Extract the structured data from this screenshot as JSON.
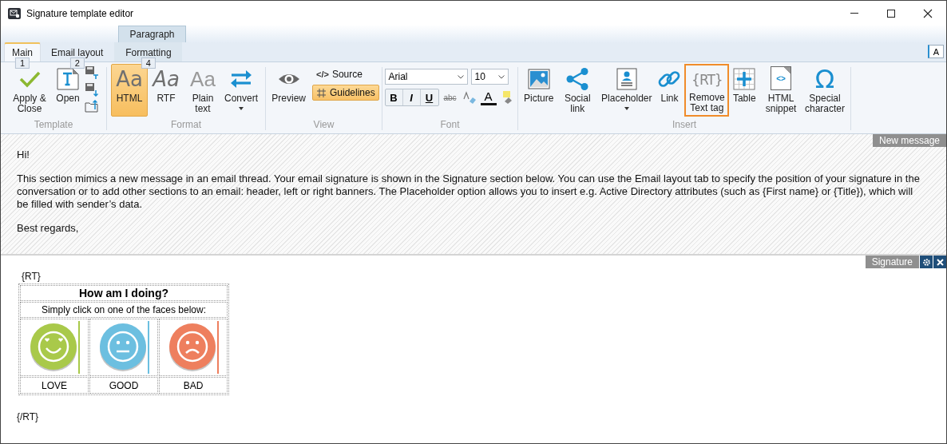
{
  "window": {
    "title": "Signature template editor"
  },
  "context_tab": {
    "label": "Paragraph"
  },
  "tabs": [
    {
      "label": "Main",
      "selected": true,
      "key_tip": "1"
    },
    {
      "label": "Email layout",
      "selected": false,
      "key_tip": "2"
    },
    {
      "label": "Formatting",
      "selected": false,
      "key_tip": "4"
    }
  ],
  "ribbon_corner_button": {
    "label": "A"
  },
  "ribbon": {
    "groups": [
      {
        "label": "Template",
        "buttons": [
          {
            "label": "Apply & Close"
          },
          {
            "label": "Open"
          }
        ]
      },
      {
        "label": "Format",
        "buttons": [
          {
            "label": "HTML",
            "icon_text": "Aa",
            "selected": true
          },
          {
            "label": "RTF",
            "icon_text": "Aa",
            "selected": false
          },
          {
            "label": "Plain text",
            "icon_text": "Aa",
            "selected": false
          },
          {
            "label": "Convert",
            "dropdown": true
          }
        ]
      },
      {
        "label": "View",
        "buttons": [
          {
            "label": "Preview"
          },
          {
            "label": "Source",
            "icon_text": "</>"
          },
          {
            "label": "Guidelines",
            "on": true
          }
        ]
      },
      {
        "label": "Font",
        "font_name": "Arial",
        "font_size": "10",
        "buttons": [
          {
            "label": "B"
          },
          {
            "label": "I"
          },
          {
            "label": "U"
          },
          {
            "label": "abc"
          },
          {
            "label": "A"
          }
        ]
      },
      {
        "label": "Insert",
        "buttons": [
          {
            "label": "Picture"
          },
          {
            "label": "Social link"
          },
          {
            "label": "Placeholder",
            "dropdown": true
          },
          {
            "label": "Link"
          },
          {
            "label": "Remove Text tag",
            "icon_text": "{RT}",
            "highlighted": true
          },
          {
            "label": "Table"
          },
          {
            "label": "HTML snippet",
            "icon_text": "<>"
          },
          {
            "label": "Special character",
            "icon_text": "Ω"
          }
        ]
      }
    ]
  },
  "message": {
    "label": "New message",
    "paragraphs": [
      "Hi!",
      "This section mimics a new message in an email thread. Your email signature is shown in the Signature section below. You can use the Email layout tab to specify the position of your signature in the conversation or to add other sections to an email: header, left or right banners. The Placeholder option allows you to insert e.g. Active Directory attributes (such as {First name} or {Title}), which will be filled with sender’s data.",
      "Best regards,"
    ]
  },
  "signature": {
    "label": "Signature",
    "open_tag": "{RT}",
    "title": "How am I doing?",
    "subtitle": "Simply click on one of the faces below:",
    "faces": [
      {
        "label": "LOVE",
        "kind": "love",
        "color": "#a9c94a"
      },
      {
        "label": "GOOD",
        "kind": "neutral",
        "color": "#6cbfe0"
      },
      {
        "label": "BAD",
        "kind": "sad",
        "color": "#ee7f5e"
      }
    ],
    "close_tag": "{/RT}"
  }
}
